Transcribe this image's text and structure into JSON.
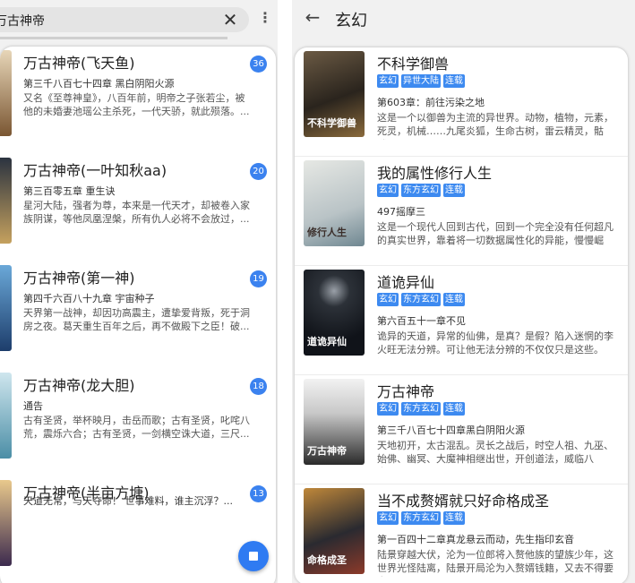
{
  "left": {
    "search": {
      "value": "万古神帝"
    },
    "results": [
      {
        "title": "万古神帝(飞天鱼)",
        "badge": "36",
        "chapter": "第三千八百七十四章 黑白阴阳火源",
        "desc": "又名《至尊神皇》，八百年前，明帝之子张若尘，被\n他的未婚妻池瑶公主杀死，一代天骄，就此殒落。..."
      },
      {
        "title": "万古神帝(一叶知秋aa)",
        "badge": "20",
        "chapter": "第三百零五章 重生诀",
        "desc": "星河大陆，强者为尊，本来是一代天才，却被卷入家\n族阴谋，等他凤凰涅槃，所有仇人必将不会放过，..."
      },
      {
        "title": "万古神帝(第一神)",
        "badge": "19",
        "chapter": "第四千六百八十九章 宇宙种子",
        "desc": "天界第一战神，却因功高震主，遭挚爱背叛，死于洞\n房之夜。葛天重生百年之后，再不做殿下之臣！破..."
      },
      {
        "title": "万古神帝(龙大胆)",
        "badge": "18",
        "chapter": "通告",
        "desc": "古有圣贤，举杯映月，击岳而歌；古有圣贤，叱咤八\n荒，震烁六合；古有圣贤，一剑横空诛大道，三尺..."
      },
      {
        "title": "万古神帝(半亩方塘)",
        "badge": "13",
        "chapter": "",
        "desc": "天道无常，与天夺命！\n    世事难料，谁主沉浮？..."
      }
    ]
  },
  "right": {
    "title": "玄幻",
    "books": [
      {
        "title": "不科学御兽",
        "tags": [
          "玄幻",
          "异世大陆",
          "连载"
        ],
        "chapter": "第603章：前往污染之地",
        "desc": "这是一个以御兽为主流的异世界。动物，植物，元素，\n死灵，机械……九尾炎狐，生命古树，雷云精灵，骷髅...",
        "cover_text": "不科学御兽",
        "cover_colors": [
          "#3a3228",
          "#8a6a3c"
        ]
      },
      {
        "title": "我的属性修行人生",
        "tags": [
          "玄幻",
          "东方玄幻",
          "连载"
        ],
        "chapter": "497摇摩三",
        "desc": "这是一个现代人回到古代，回到一个完全没有任何超凡\n的真实世界，靠着将一切数据属性化的异能，慢慢崛起...",
        "cover_text": "修行人生",
        "cover_colors": [
          "#d9dcd7",
          "#6f8791"
        ]
      },
      {
        "title": "道诡异仙",
        "tags": [
          "玄幻",
          "东方玄幻",
          "连载"
        ],
        "chapter": "第六百五十一章不见",
        "desc": "诡异的天道，异常的仙佛，是真？是假？陷入迷惘的李\n火旺无法分辨。可让他无法分辨的不仅仅只是这些。还...",
        "cover_text": "道诡异仙",
        "cover_colors": [
          "#101319",
          "#3a4048"
        ]
      },
      {
        "title": "万古神帝",
        "tags": [
          "玄幻",
          "东方玄幻",
          "连载"
        ],
        "chapter": "第三千八百七十四章黑白阴阳火源",
        "desc": "天地初开，太古混乱。灵长之战后，时空人祖、九巫、\n始佛、幽冥、大魔神相继出世，开创道法，威临八方，...",
        "cover_text": "万古神帝",
        "cover_colors": [
          "#f0f0f0",
          "#2a2a2a"
        ]
      },
      {
        "title": "当不成赘婿就只好命格成圣",
        "tags": [
          "玄幻",
          "东方玄幻",
          "连载"
        ],
        "chapter": "第一百四十二章真龙悬云而动，先生指印玄音",
        "desc": "陆景穿越大伏，沦为一位郎将入赘他族的望族少年，这\n世界光怪陆离，陆景开局沦为入赘婿钱籍，又去不得要家...",
        "cover_text": "命格成圣",
        "cover_colors": [
          "#2a2a30",
          "#c0883a"
        ]
      }
    ]
  }
}
